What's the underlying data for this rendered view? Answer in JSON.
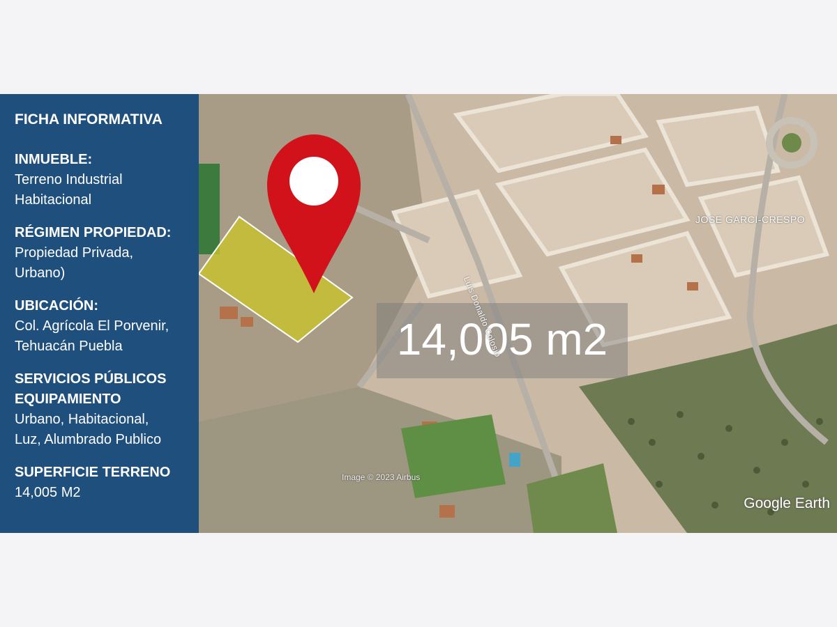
{
  "panel": {
    "title": "FICHA INFORMATIVA",
    "sections": [
      {
        "heading": "INMUEBLE:",
        "value": "Terreno Industrial\nHabitacional"
      },
      {
        "heading": "RÉGIMEN PROPIEDAD:",
        "value": "Propiedad Privada,\nUrbano)"
      },
      {
        "heading": "UBICACIÓN:",
        "value": "Col. Agrícola El Porvenir,\nTehuacán Puebla"
      },
      {
        "heading": "SERVICIOS PÚBLICOS\nEQUIPAMIENTO",
        "value": "Urbano, Habitacional,\nLuz, Alumbrado Publico"
      },
      {
        "heading": "SUPERFICIE TERRENO",
        "value": "14,005 M2"
      }
    ]
  },
  "map": {
    "area_label": "14,005 m2",
    "street_1": "JOSE GARCI-CRESPO",
    "street_2": "Luis Donaldo Colosio",
    "imagery_credit": "Image © 2023 Airbus",
    "logo": "Google Earth",
    "plot_color": "#c9c32a",
    "pin_color": "#d2121a"
  }
}
